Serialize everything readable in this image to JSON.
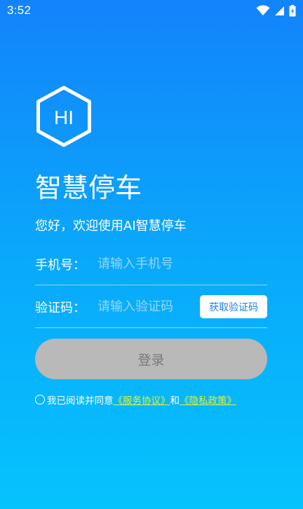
{
  "status_bar": {
    "time": "3:52",
    "icons": [
      "wifi-icon",
      "signal-icon",
      "battery-icon"
    ]
  },
  "logo": {
    "text": "HI",
    "icon": "hexagon-logo-icon"
  },
  "header": {
    "title": "智慧停车",
    "welcome": "您好，欢迎使用AI智慧停车"
  },
  "form": {
    "phone": {
      "label": "手机号：",
      "placeholder": "请输入手机号",
      "value": ""
    },
    "code": {
      "label": "验证码：",
      "placeholder": "请输入验证码",
      "value": "",
      "button_label": "获取验证码"
    },
    "login_label": "登录"
  },
  "agreement": {
    "checked": false,
    "prefix": "我已阅读并同意",
    "service_link": "《服务协议》",
    "conjunction": "和",
    "privacy_link": "《隐私政策》"
  },
  "colors": {
    "gradient_top": "#1383fb",
    "gradient_bottom": "#05c3fd",
    "link": "#e7f02a",
    "login_disabled_bg": "#b9b9b9",
    "code_button_text": "#1a7ef6"
  }
}
